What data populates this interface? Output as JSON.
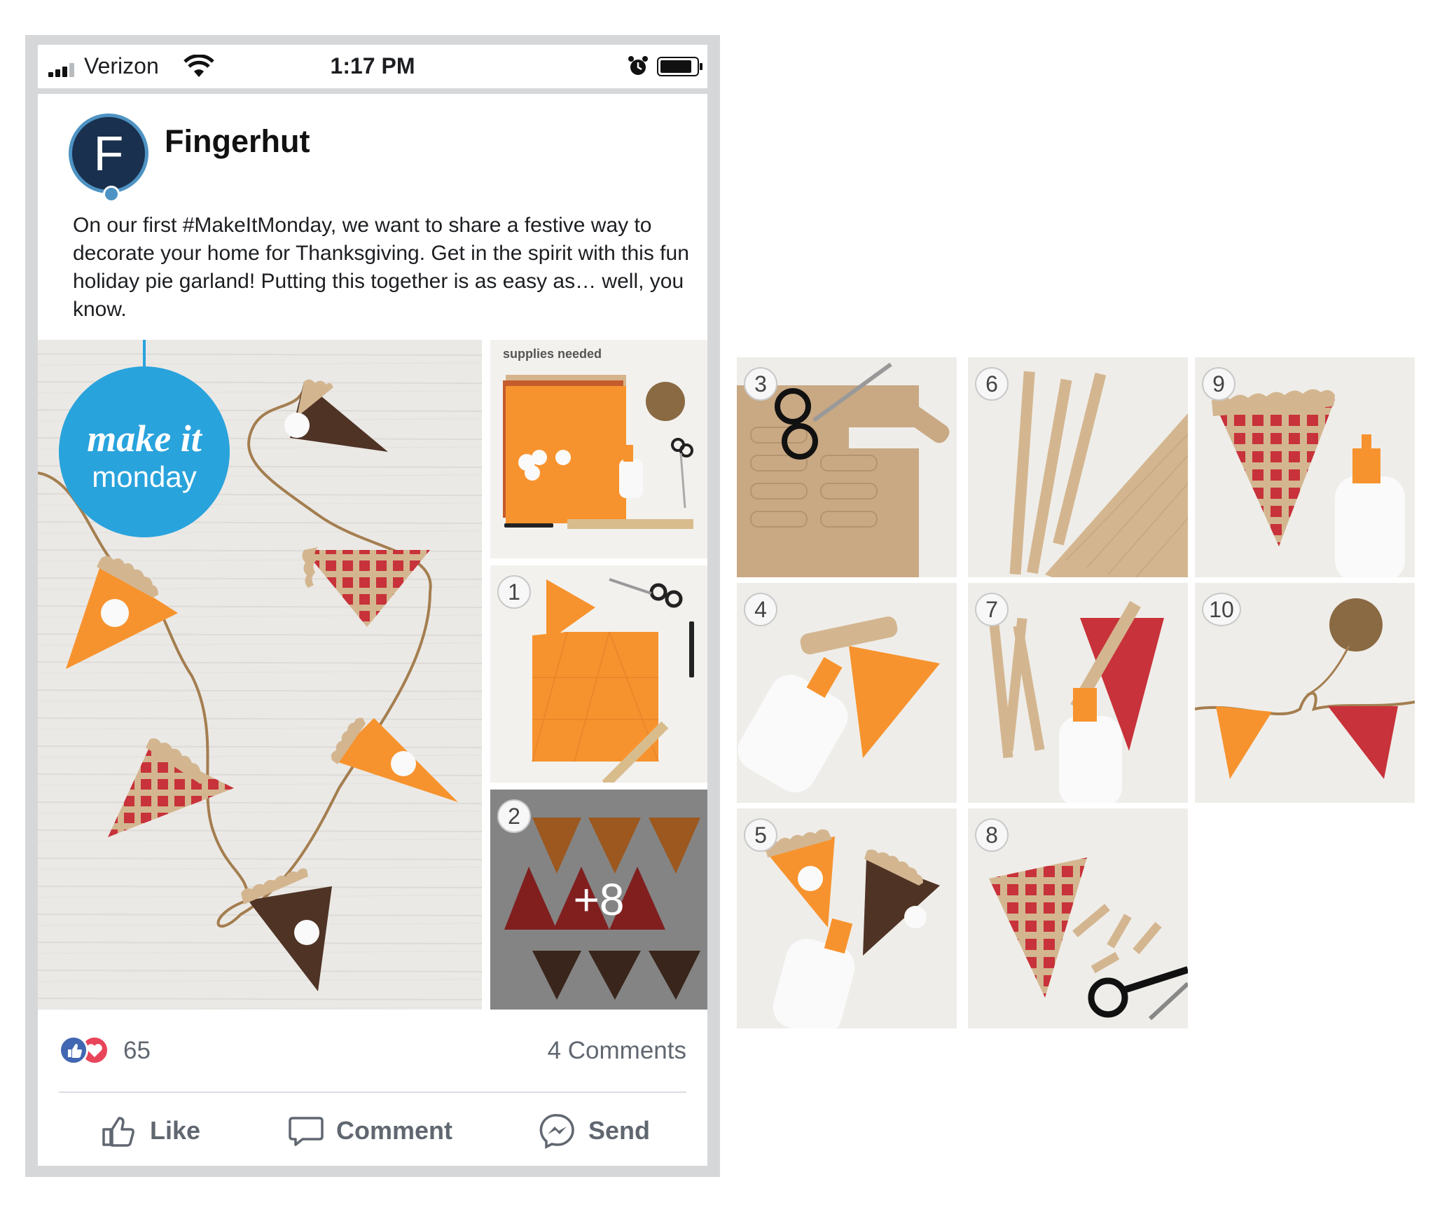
{
  "status_bar": {
    "carrier": "Verizon",
    "time": "1:17 PM"
  },
  "post": {
    "page_name": "Fingerhut",
    "avatar_letter": "F",
    "caption": "On our first #MakeItMonday, we want to share a festive way to decorate your home for Thanksgiving. Get in the spirit with this fun holiday pie garland! Putting this together is as easy as… well, you know.",
    "badge_line1": "make it",
    "badge_line2": "monday",
    "supplies_label": "supplies needed",
    "more_photos": "+8",
    "reaction_count": "65",
    "comment_count": "4 Comments"
  },
  "actions": {
    "like": "Like",
    "comment": "Comment",
    "send": "Send"
  },
  "steps": [
    "1",
    "2",
    "3",
    "4",
    "5",
    "6",
    "7",
    "8",
    "9",
    "10"
  ],
  "colors": {
    "facebook_blue": "#4267b2",
    "love_red": "#e8445a",
    "pie_orange": "#f7932e",
    "pie_brown": "#4f3426",
    "lattice_red": "#c8323a",
    "crust_tan": "#d3b690",
    "badge_blue": "#29a3dc"
  }
}
